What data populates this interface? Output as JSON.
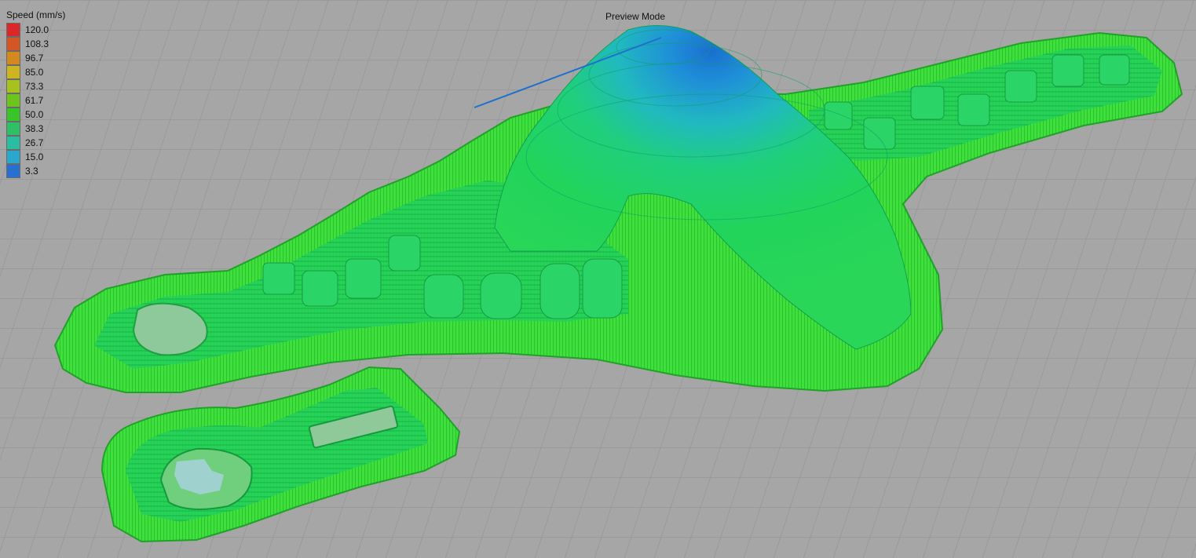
{
  "viewport": {
    "mode_label": "Preview Mode"
  },
  "legend": {
    "title": "Speed (mm/s)",
    "entries": [
      {
        "value": "120.0",
        "color": "#d8282a"
      },
      {
        "value": "108.3",
        "color": "#d45624"
      },
      {
        "value": "96.7",
        "color": "#d3891f"
      },
      {
        "value": "85.0",
        "color": "#cdb51f"
      },
      {
        "value": "73.3",
        "color": "#a7c21e"
      },
      {
        "value": "61.7",
        "color": "#6dc41d"
      },
      {
        "value": "50.0",
        "color": "#38c52a"
      },
      {
        "value": "38.3",
        "color": "#2fbf67"
      },
      {
        "value": "26.7",
        "color": "#2bbda0"
      },
      {
        "value": "15.0",
        "color": "#2aa7cc"
      },
      {
        "value": "3.3",
        "color": "#2870cf"
      }
    ]
  },
  "colors": {
    "grid_background": "#a6a6a6",
    "grid_line": "#8e8e8e",
    "fast_green": "#3fe23f",
    "mid_green": "#19c95a",
    "slow_blue": "#1f78d0"
  }
}
